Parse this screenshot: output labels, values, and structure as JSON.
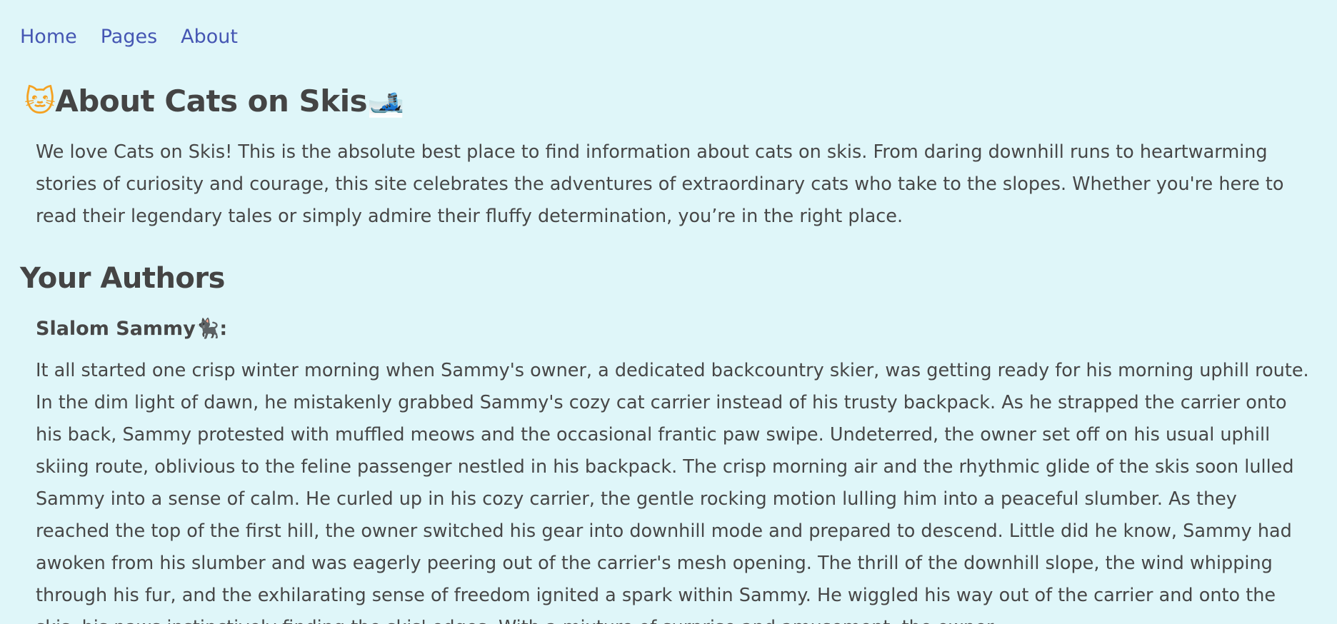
{
  "nav": {
    "items": [
      "Home",
      "Pages",
      "About"
    ]
  },
  "header": {
    "title": "About Cats on Skis",
    "left_icon": "🐱",
    "right_icon": "🎿"
  },
  "intro": {
    "text": "We love Cats on Skis! This is the absolute best place to find information about cats on skis. From daring downhill runs to heartwarming stories of curiosity and courage, this site celebrates the adventures of extraordinary cats who take to the slopes. Whether you're here to read their legendary tales or simply admire their fluffy determination, you’re in the right place."
  },
  "authors": {
    "heading": "Your Authors",
    "name": "Slalom Sammy",
    "name_icon": "🐈‍⬛",
    "name_suffix": ":",
    "story": "It all started one crisp winter morning when Sammy's owner, a dedicated backcountry skier, was getting ready for his morning uphill route. In the dim light of dawn, he mistakenly grabbed Sammy's cozy cat carrier instead of his trusty backpack. As he strapped the carrier onto his back, Sammy protested with muffled meows and the occasional frantic paw swipe. Undeterred, the owner set off on his usual uphill skiing route, oblivious to the feline passenger nestled in his backpack. The crisp morning air and the rhythmic glide of the skis soon lulled Sammy into a sense of calm. He curled up in his cozy carrier, the gentle rocking motion lulling him into a peaceful slumber. As they reached the top of the first hill, the owner switched his gear into downhill mode and prepared to descend. Little did he know, Sammy had awoken from his slumber and was eagerly peering out of the carrier's mesh opening. The thrill of the downhill slope, the wind whipping through his fur, and the exhilarating sense of freedom ignited a spark within Sammy. He wiggled his way out of the carrier and onto the skis, his paws instinctively finding the skis' edges. With a mixture of surprise and amusement, the owner"
  },
  "colors": {
    "background": "#dff6f9",
    "link": "#4556b3",
    "text": "#474747"
  }
}
